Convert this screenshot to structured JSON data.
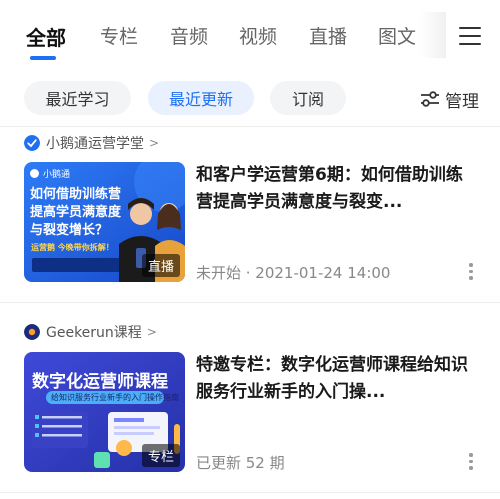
{
  "tabs": [
    {
      "label": "全部"
    },
    {
      "label": "专栏"
    },
    {
      "label": "音频"
    },
    {
      "label": "视频"
    },
    {
      "label": "直播"
    },
    {
      "label": "图文"
    }
  ],
  "filters": [
    {
      "label": "最近学习"
    },
    {
      "label": "最近更新"
    },
    {
      "label": "订阅"
    }
  ],
  "manage_label": "管理",
  "items": [
    {
      "source": "小鹅通运营学堂",
      "title": "和客户学运营第6期：如何借助训练营提高学员满意度与裂变...",
      "meta": "未开始 · 2021-01-24 14:00",
      "badge": "直播",
      "thumb": {
        "brand": "小鹅通",
        "lines": [
          "如何借助训练营",
          "提高学员满意度",
          "与裂变增长？"
        ],
        "small": "运营鹅  今晚带你拆解！"
      }
    },
    {
      "source": "Geekerun课程",
      "title": "特邀专栏：数字化运营师课程给知识服务行业新手的入门操...",
      "meta": "已更新 52 期",
      "badge": "专栏",
      "thumb": {
        "headline": "数字化运营师课程",
        "sub": "给知识服务行业新手的入门操作指南"
      }
    }
  ],
  "colors": {
    "accent": "#1f6ff2",
    "chip_bg": "#f3f4f6",
    "chip_active_bg": "#e9f1ff"
  }
}
